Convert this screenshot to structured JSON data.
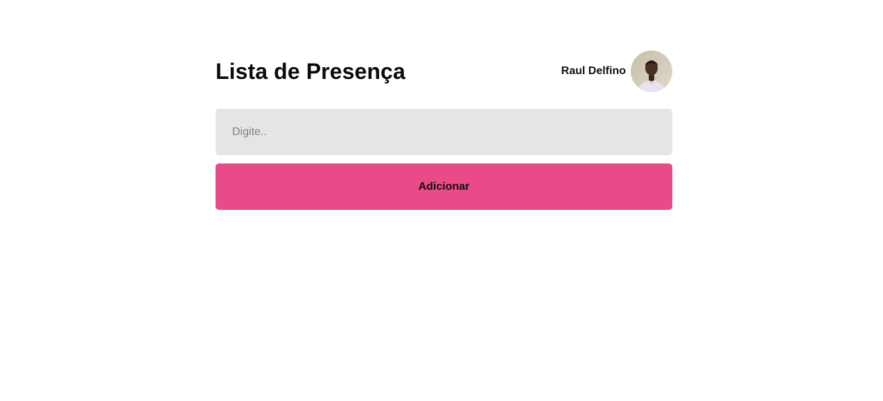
{
  "header": {
    "title": "Lista de Presença",
    "user": {
      "name": "Raul Delfino",
      "avatar_icon": "user-avatar-photo"
    }
  },
  "form": {
    "input": {
      "placeholder": "Digite..",
      "value": ""
    },
    "submit_label": "Adicionar"
  },
  "colors": {
    "accent": "#e94b88",
    "input_bg": "#e5e5e5",
    "page_bg": "#ffffff"
  }
}
